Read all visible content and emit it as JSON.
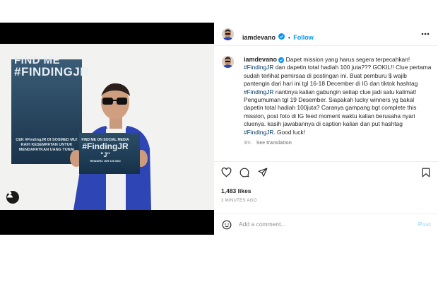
{
  "header": {
    "username": "iamdevano",
    "separator": "•",
    "follow_label": "Follow"
  },
  "poster": {
    "title_line1": "FIND ME",
    "title_line2": "#FINDINGJR",
    "body": "CEK #FindingJR DI SOSMED MU! RAIH KESEMPATAN UNTUK MENDAPATKAN UANG TUNAI",
    "sign_line1": "FIND ME ON SOCIAL MEDIA",
    "sign_line2": "#FindingJR",
    "sign_line3": "\"J\"",
    "sign_line4": "REWARD: IDR 100 MIO"
  },
  "caption": {
    "username": "iamdevano",
    "text_1": " Dapet mission yang harus segera terpecahkan! ",
    "tag_1": "#FindingJR",
    "text_2": " dan dapetin total hadiah 100 juta??? GOKIL!! Clue pertama sudah terlihat pemirsaa di postingan ini. Buat pemburu $ wajib pantengin dari hari ini tgl 16-18 December di IG dan tiktok hashtag ",
    "tag_2": "#FindingJR",
    "text_3": " nantinya kalian gabungin setiap clue jadi satu kalimat! Pengumuman tgl 19 Desember. Siapakah lucky winners yg bakal dapetin total hadiah 100juta? Caranya gampang bgt complete this mission, post foto di IG feed moment waktu kalian berusaha nyari cluenya. kasih jawabannya di caption kalian dan put hashtag ",
    "tag_3": "#FindingJR",
    "text_4": ". Good luck!",
    "age": "3m",
    "see_translation": "See translation"
  },
  "likes": "1,483 likes",
  "timestamp": "3 MINUTES AGO",
  "comment": {
    "placeholder": "Add a comment...",
    "post_label": "Post"
  },
  "icons": [
    "more-icon",
    "heart-icon",
    "comment-icon",
    "share-icon",
    "bookmark-icon",
    "emoji-icon",
    "verified-icon",
    "tagged-user-icon"
  ],
  "colors": {
    "accent": "#0095f6",
    "hashtag": "#00376b",
    "muted": "#8e8e8e",
    "poster_bg": "#1f3d57",
    "jacket": "#2d45b5"
  }
}
